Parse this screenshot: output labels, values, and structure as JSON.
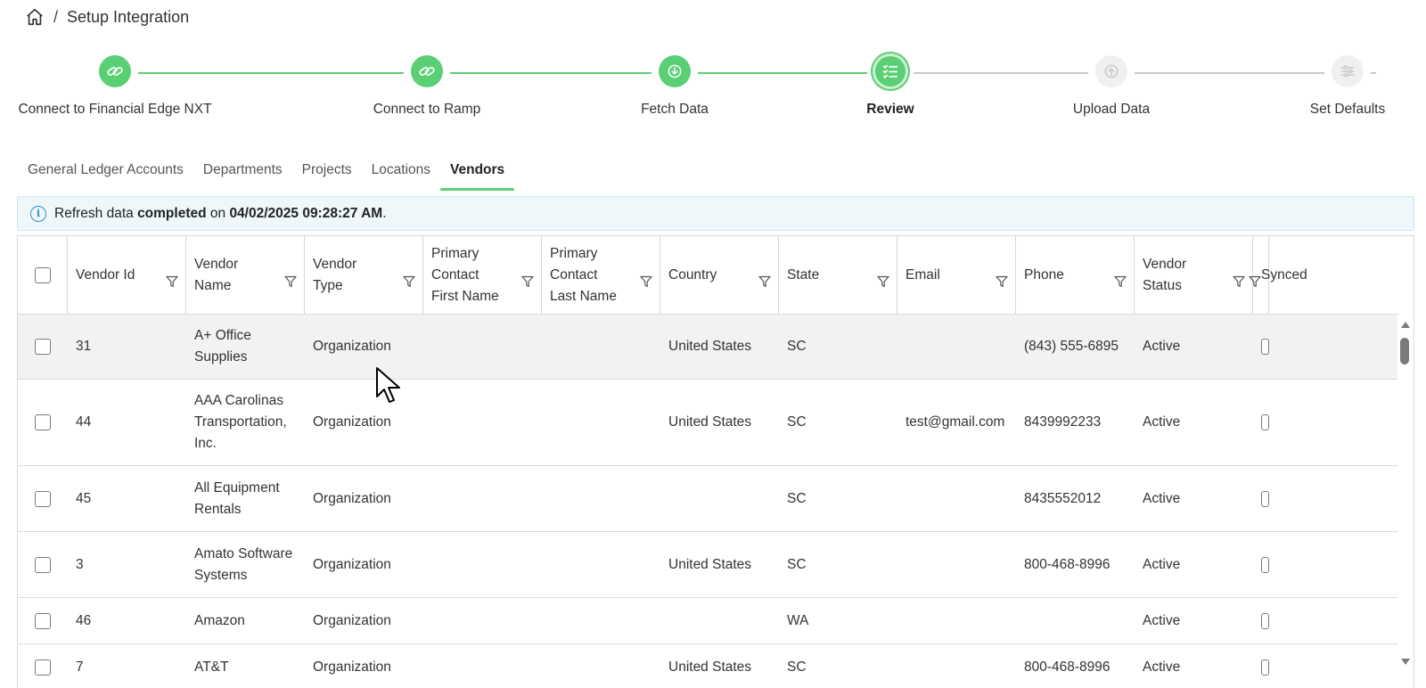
{
  "breadcrumb": {
    "separator": "/",
    "title": "Setup Integration"
  },
  "colors": {
    "accent": "#5bcf74",
    "info": "#2f8fc9"
  },
  "stepper": {
    "steps": [
      {
        "label": "Connect to Financial Edge NXT",
        "status": "done",
        "icon": "link-icon"
      },
      {
        "label": "Connect to Ramp",
        "status": "done",
        "icon": "link-icon"
      },
      {
        "label": "Fetch Data",
        "status": "done",
        "icon": "download-icon"
      },
      {
        "label": "Review",
        "status": "active",
        "icon": "checklist-icon"
      },
      {
        "label": "Upload Data",
        "status": "pending",
        "icon": "upload-icon"
      },
      {
        "label": "Set Defaults",
        "status": "pending",
        "icon": "sliders-icon"
      }
    ]
  },
  "tabs": [
    {
      "label": "General Ledger Accounts",
      "active": false
    },
    {
      "label": "Departments",
      "active": false
    },
    {
      "label": "Projects",
      "active": false
    },
    {
      "label": "Locations",
      "active": false
    },
    {
      "label": "Vendors",
      "active": true
    }
  ],
  "banner": {
    "prefix": "Refresh data ",
    "status": "completed",
    "middle": " on ",
    "timestamp": "04/02/2025 09:28:27 AM",
    "suffix": "."
  },
  "table": {
    "columns": [
      {
        "lines": [
          "Vendor Id"
        ]
      },
      {
        "lines": [
          "Vendor",
          "Name"
        ]
      },
      {
        "lines": [
          "Vendor",
          "Type"
        ]
      },
      {
        "lines": [
          "Primary",
          "Contact",
          "First Name"
        ]
      },
      {
        "lines": [
          "Primary",
          "Contact",
          "Last Name"
        ]
      },
      {
        "lines": [
          "Country"
        ]
      },
      {
        "lines": [
          "State"
        ]
      },
      {
        "lines": [
          "Email"
        ]
      },
      {
        "lines": [
          "Phone"
        ]
      },
      {
        "lines": [
          "Vendor",
          "Status"
        ]
      },
      {
        "lines": [
          "Synced"
        ]
      }
    ],
    "rows": [
      {
        "id": "31",
        "name": [
          "A+ Office",
          "Supplies"
        ],
        "type": "Organization",
        "first": "",
        "last": "",
        "country": "United States",
        "state": "SC",
        "email": "",
        "phone": "(843) 555-6895",
        "status": "Active"
      },
      {
        "id": "44",
        "name": [
          "AAA Carolinas",
          "Transportation,",
          "Inc."
        ],
        "type": "Organization",
        "first": "",
        "last": "",
        "country": "United States",
        "state": "SC",
        "email": "test@gmail.com",
        "phone": "8439992233",
        "status": "Active"
      },
      {
        "id": "45",
        "name": [
          "All Equipment",
          "Rentals"
        ],
        "type": "Organization",
        "first": "",
        "last": "",
        "country": "",
        "state": "SC",
        "email": "",
        "phone": "8435552012",
        "status": "Active"
      },
      {
        "id": "3",
        "name": [
          "Amato Software",
          "Systems"
        ],
        "type": "Organization",
        "first": "",
        "last": "",
        "country": "United States",
        "state": "SC",
        "email": "",
        "phone": "800-468-8996",
        "status": "Active"
      },
      {
        "id": "46",
        "name": [
          "Amazon"
        ],
        "type": "Organization",
        "first": "",
        "last": "",
        "country": "",
        "state": "WA",
        "email": "",
        "phone": "",
        "status": "Active"
      },
      {
        "id": "7",
        "name": [
          "AT&T"
        ],
        "type": "Organization",
        "first": "",
        "last": "",
        "country": "United States",
        "state": "SC",
        "email": "",
        "phone": "800-468-8996",
        "status": "Active"
      }
    ]
  }
}
